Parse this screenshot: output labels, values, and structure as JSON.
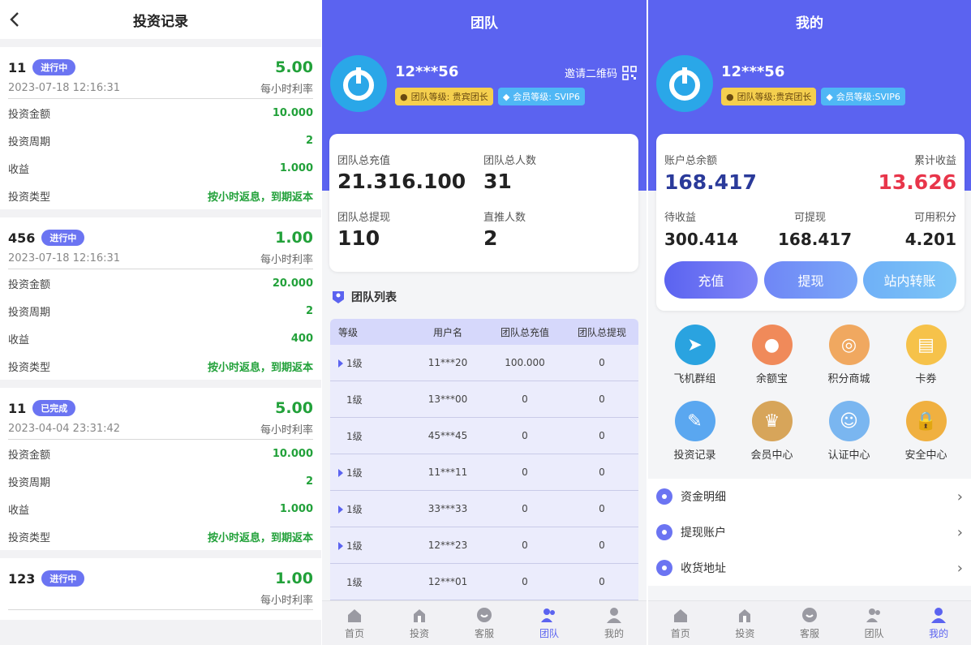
{
  "records": {
    "title": "投资记录",
    "labels": {
      "hourly_rate": "每小时利率",
      "amount": "投资金额",
      "period": "投资周期",
      "income": "收益",
      "type": "投资类型"
    },
    "items": [
      {
        "id": "11",
        "status": "进行中",
        "rate": "5.00",
        "time": "2023-07-18 12:16:31",
        "amount": "10.000",
        "period": "2",
        "income": "1.000",
        "type": "按小时返息，到期返本"
      },
      {
        "id": "456",
        "status": "进行中",
        "rate": "1.00",
        "time": "2023-07-18 12:16:31",
        "amount": "20.000",
        "period": "2",
        "income": "400",
        "type": "按小时返息，到期返本"
      },
      {
        "id": "11",
        "status": "已完成",
        "rate": "5.00",
        "time": "2023-04-04 23:31:42",
        "amount": "10.000",
        "period": "2",
        "income": "1.000",
        "type": "按小时返息，到期返本"
      },
      {
        "id": "123",
        "status": "进行中",
        "rate": "1.00",
        "time": "",
        "amount": "",
        "period": "",
        "income": "",
        "type": ""
      }
    ]
  },
  "team": {
    "title": "团队",
    "username": "12***56",
    "invite": "邀请二维码",
    "team_level": "团队等级: 贵宾团长",
    "member_level": "会员等级: SVIP6",
    "stats": {
      "recharge_label": "团队总充值",
      "recharge": "21.316.100",
      "people_label": "团队总人数",
      "people": "31",
      "withdraw_label": "团队总提现",
      "withdraw": "110",
      "direct_label": "直推人数",
      "direct": "2"
    },
    "list_title": "团队列表",
    "columns": [
      "等级",
      "用户名",
      "团队总充值",
      "团队总提现"
    ],
    "rows": [
      {
        "level": "1级",
        "user": "11***20",
        "recharge": "100.000",
        "withdraw": "0",
        "expand": true
      },
      {
        "level": "1级",
        "user": "13***00",
        "recharge": "0",
        "withdraw": "0",
        "expand": false
      },
      {
        "level": "1级",
        "user": "45***45",
        "recharge": "0",
        "withdraw": "0",
        "expand": false
      },
      {
        "level": "1级",
        "user": "11***11",
        "recharge": "0",
        "withdraw": "0",
        "expand": true
      },
      {
        "level": "1级",
        "user": "33***33",
        "recharge": "0",
        "withdraw": "0",
        "expand": true
      },
      {
        "level": "1级",
        "user": "12***23",
        "recharge": "0",
        "withdraw": "0",
        "expand": true
      },
      {
        "level": "1级",
        "user": "12***01",
        "recharge": "0",
        "withdraw": "0",
        "expand": false
      }
    ]
  },
  "tabs": [
    "首页",
    "投资",
    "客服",
    "团队",
    "我的"
  ],
  "mine": {
    "title": "我的",
    "username": "12***56",
    "team_level": "团队等级:贵宾团长",
    "member_level": "会员等级:SVIP6",
    "balance_label": "账户总余额",
    "balance": "168.417",
    "earnings_label": "累计收益",
    "earnings": "13.626",
    "pending_label": "待收益",
    "pending": "300.414",
    "withdrawable_label": "可提现",
    "withdrawable": "168.417",
    "points_label": "可用积分",
    "points": "4.201",
    "btn_recharge": "充值",
    "btn_withdraw": "提现",
    "btn_transfer": "站内转账",
    "grid": [
      "飞机群组",
      "余额宝",
      "积分商城",
      "卡券",
      "投资记录",
      "会员中心",
      "认证中心",
      "安全中心"
    ],
    "menu": [
      "资金明细",
      "提现账户",
      "收货地址"
    ]
  },
  "colors": {
    "primary": "#5b63f0",
    "green": "#22a13a",
    "red": "#e8354a",
    "navy": "#2a3a9a"
  }
}
